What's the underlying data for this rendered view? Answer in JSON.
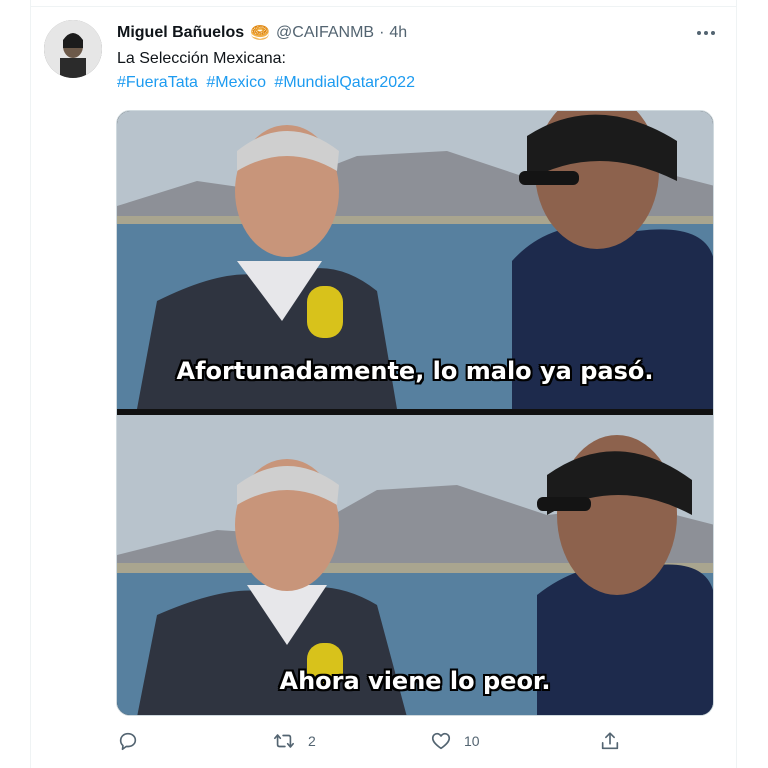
{
  "tweet": {
    "author_name": "Miguel Bañuelos",
    "author_emoji": "🥯",
    "handle": "@CAIFANMB",
    "separator": "·",
    "time": "4h",
    "text": "La Selección Mexicana:",
    "hashtags": [
      "#FueraTata",
      "#Mexico",
      "#MundialQatar2022"
    ],
    "more_icon": "more-horizontal-icon"
  },
  "media": {
    "caption_top": "Afortunadamente, lo malo ya pasó.",
    "caption_bottom": "Ahora viene lo peor."
  },
  "actions": {
    "reply_count": "",
    "retweet_count": "2",
    "like_count": "10",
    "share_count": ""
  },
  "colors": {
    "accent": "#1d9bf0",
    "secondary_text": "#536471"
  }
}
